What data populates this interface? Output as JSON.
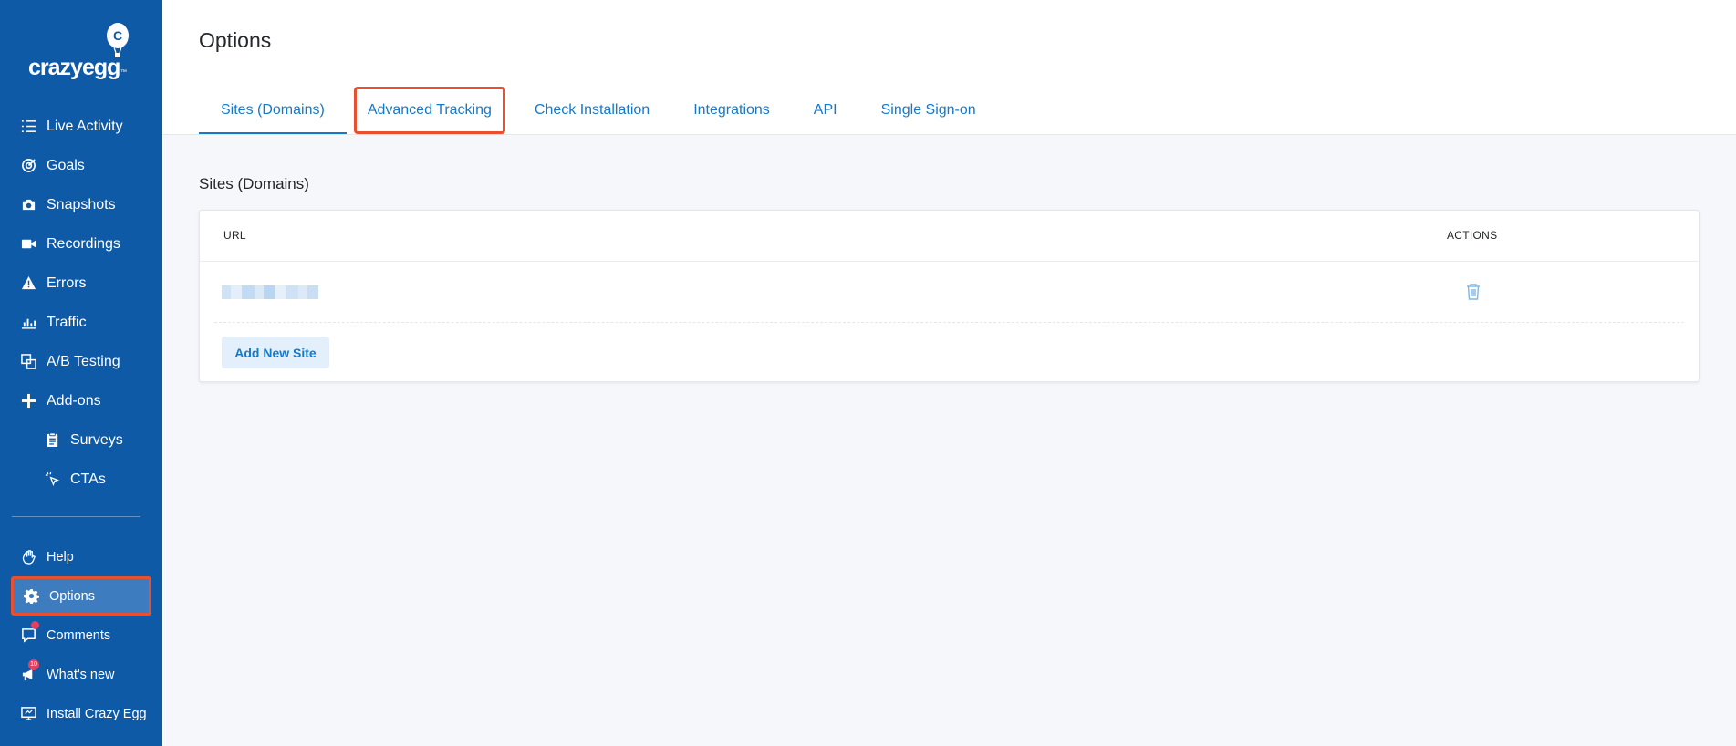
{
  "brand": {
    "logo_text": "crazyegg",
    "logo_tm": "™",
    "color": "#0e5aa7",
    "accent": "#1579c9",
    "highlight": "#e8502f"
  },
  "sidebar": {
    "items": [
      {
        "label": "Live Activity",
        "icon": "list-icon"
      },
      {
        "label": "Goals",
        "icon": "target-icon"
      },
      {
        "label": "Snapshots",
        "icon": "camera-icon"
      },
      {
        "label": "Recordings",
        "icon": "video-icon"
      },
      {
        "label": "Errors",
        "icon": "warning-icon"
      },
      {
        "label": "Traffic",
        "icon": "bar-chart-icon"
      },
      {
        "label": "A/B Testing",
        "icon": "ab-icon"
      },
      {
        "label": "Add-ons",
        "icon": "plus-icon"
      },
      {
        "label": "Surveys",
        "icon": "clipboard-icon"
      },
      {
        "label": "CTAs",
        "icon": "cursor-click-icon"
      }
    ],
    "bottom_items": [
      {
        "label": "Help",
        "icon": "hand-wave-icon"
      },
      {
        "label": "Options",
        "icon": "gear-icon",
        "active": true
      },
      {
        "label": "Comments",
        "icon": "comment-icon"
      },
      {
        "label": "What's new",
        "icon": "megaphone-icon",
        "badge": "10"
      },
      {
        "label": "Install Crazy Egg",
        "icon": "monitor-icon"
      }
    ]
  },
  "header": {
    "title": "Options",
    "tabs": [
      {
        "label": "Sites (Domains)",
        "active": true
      },
      {
        "label": "Advanced Tracking",
        "highlighted": true
      },
      {
        "label": "Check Installation"
      },
      {
        "label": "Integrations"
      },
      {
        "label": "API"
      },
      {
        "label": "Single Sign-on"
      }
    ]
  },
  "main": {
    "section_title": "Sites (Domains)",
    "table": {
      "columns": [
        "URL",
        "ACTIONS"
      ],
      "add_button": "Add New Site"
    }
  }
}
